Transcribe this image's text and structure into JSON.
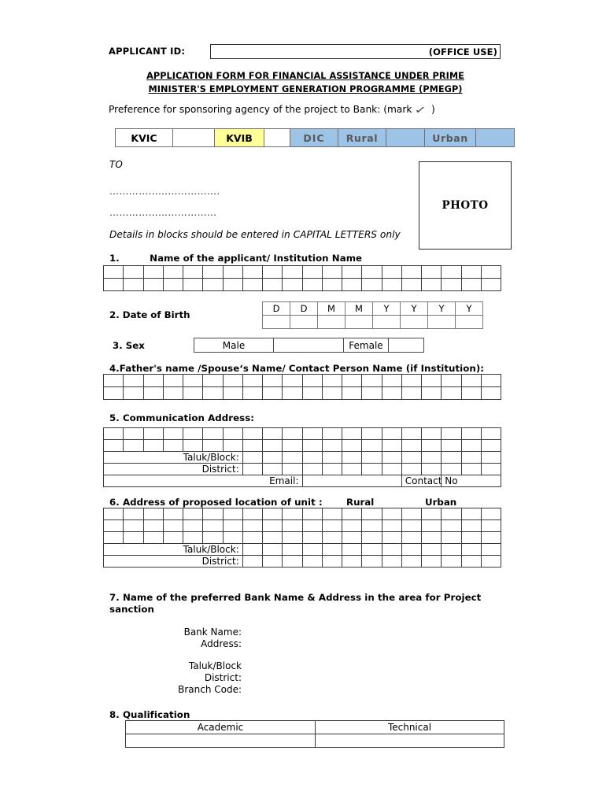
{
  "header": {
    "applicant_id_label": "APPLICANT ID:",
    "office_use": "(OFFICE USE)",
    "title_line1": "APPLICATION FORM FOR FINANCIAL ASSISTANCE UNDER PRIME",
    "title_line2": "MINISTER'S EMPLOYMENT GENERATION PROGRAMME (PMEGP)",
    "preference_text_before": "Preference for sponsoring agency of the project to Bank: (mark",
    "check_glyph": "✓",
    "preference_text_after": ")"
  },
  "agency_row": {
    "cells": [
      {
        "label": "KVIC",
        "color": "#ffffff",
        "text_color": "#000000"
      },
      {
        "label": "",
        "color": "#ffffff",
        "text_color": "#000000"
      },
      {
        "label": "KVIB",
        "color": "#ffff99",
        "text_color": "#000000"
      },
      {
        "label": "",
        "color": "#ffffff",
        "text_color": "#000000"
      },
      {
        "label": "DIC",
        "color": "#9dc3e6",
        "text_color": "#595959"
      },
      {
        "label": "Rural",
        "color": "#9dc3e6",
        "text_color": "#595959"
      },
      {
        "label": "",
        "color": "#9dc3e6",
        "text_color": "#595959"
      },
      {
        "label": "Urban",
        "color": "#9dc3e6",
        "text_color": "#595959"
      },
      {
        "label": "",
        "color": "#9dc3e6",
        "text_color": "#595959"
      }
    ]
  },
  "to_block": {
    "to_label": "TO",
    "dots_line1": "…………………………….",
    "dots_line2": "……………………………",
    "capital_note": "Details in blocks should be entered in CAPITAL LETTERS only",
    "photo_label": "PHOTO"
  },
  "sections": {
    "s1": {
      "number": "1.",
      "title": "Name of the applicant/ Institution Name",
      "columns": 20,
      "rows": 2
    },
    "s2": {
      "title": "2. Date of Birth",
      "header_cells": [
        "D",
        "D",
        "M",
        "M",
        "Y",
        "Y",
        "Y",
        "Y"
      ]
    },
    "s3": {
      "title": "3.  Sex",
      "male_label": "Male",
      "female_label": "Female"
    },
    "s4": {
      "title": "4.Father's name /Spouse‘s Name/ Contact Person Name (if Institution):",
      "columns": 20,
      "rows": 2
    },
    "s5": {
      "title": "5. Communication Address:",
      "columns": 20,
      "blank_rows": 2,
      "taluk_label": "Taluk/Block:",
      "district_label": "District:",
      "email_label": "Email:",
      "contact_label": "Contact No"
    },
    "s6": {
      "title": "6. Address of proposed location of unit :",
      "rural_label": "Rural",
      "urban_label": "Urban",
      "columns": 20,
      "blank_rows": 3,
      "taluk_label": "Taluk/Block:",
      "district_label": "District:"
    },
    "s7": {
      "title": "7. Name of the preferred Bank  Name & Address in the area for Project sanction",
      "fields": [
        "Bank Name:",
        "Address:",
        "",
        "Taluk/Block",
        "District:",
        "Branch Code:"
      ]
    },
    "s8": {
      "title": "8. Qualification",
      "headers": [
        "Academic",
        "Technical"
      ]
    }
  }
}
